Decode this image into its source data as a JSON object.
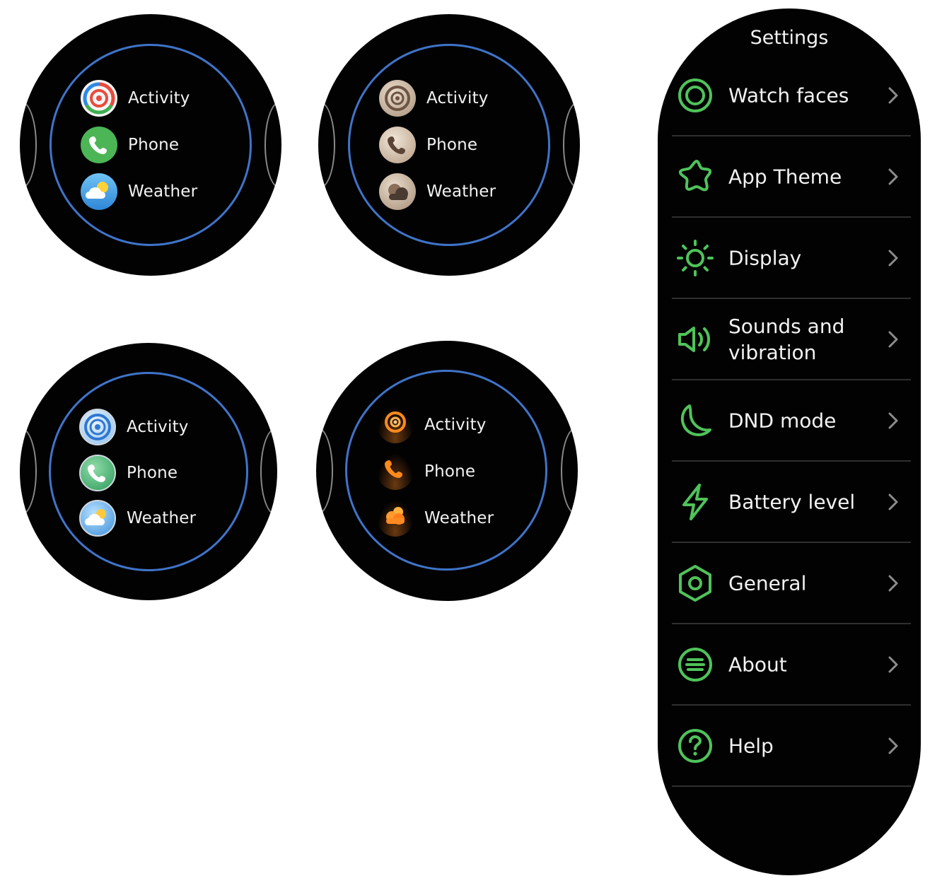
{
  "watches": [
    {
      "theme": "colorful",
      "apps": [
        {
          "label": "Activity",
          "icon": "activity-icon"
        },
        {
          "label": "Phone",
          "icon": "phone-icon"
        },
        {
          "label": "Weather",
          "icon": "weather-icon"
        }
      ]
    },
    {
      "theme": "sepia",
      "apps": [
        {
          "label": "Activity",
          "icon": "activity-icon"
        },
        {
          "label": "Phone",
          "icon": "phone-icon"
        },
        {
          "label": "Weather",
          "icon": "weather-icon"
        }
      ]
    },
    {
      "theme": "glass-blue",
      "apps": [
        {
          "label": "Activity",
          "icon": "activity-icon"
        },
        {
          "label": "Phone",
          "icon": "phone-icon"
        },
        {
          "label": "Weather",
          "icon": "weather-icon"
        }
      ]
    },
    {
      "theme": "orange-glow",
      "apps": [
        {
          "label": "Activity",
          "icon": "activity-icon"
        },
        {
          "label": "Phone",
          "icon": "phone-icon"
        },
        {
          "label": "Weather",
          "icon": "weather-icon"
        }
      ]
    }
  ],
  "settings": {
    "title": "Settings",
    "accent_color": "#4fc35a",
    "items": [
      {
        "label": "Watch faces",
        "icon": "watch-face-icon"
      },
      {
        "label": "App Theme",
        "icon": "star-theme-icon"
      },
      {
        "label": "Display",
        "icon": "sun-icon"
      },
      {
        "label": "Sounds and vibration",
        "icon": "speaker-icon"
      },
      {
        "label": "DND mode",
        "icon": "moon-icon"
      },
      {
        "label": "Battery level",
        "icon": "lightning-icon"
      },
      {
        "label": "General",
        "icon": "hexagon-gear-icon"
      },
      {
        "label": "About",
        "icon": "about-icon"
      },
      {
        "label": "Help",
        "icon": "help-icon"
      }
    ]
  },
  "colors": {
    "ring": "#3f74c9",
    "watch_bg": "#020202",
    "text": "#f2f2f2"
  }
}
